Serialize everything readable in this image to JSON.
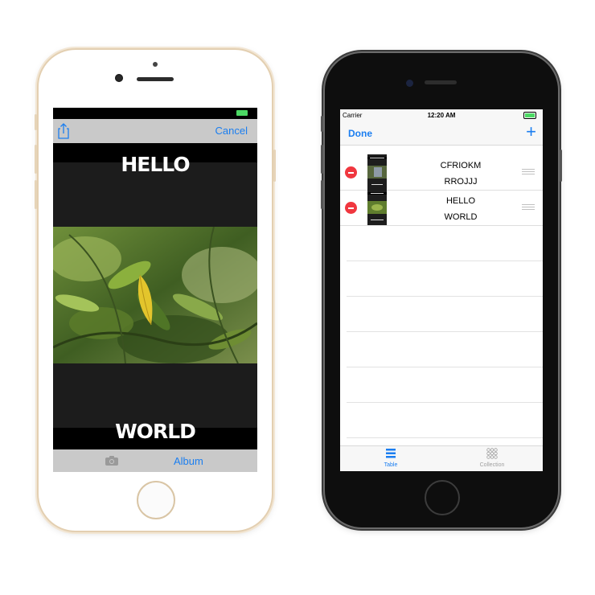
{
  "editor_screen": {
    "nav": {
      "cancel_label": "Cancel",
      "share_icon": "share-icon"
    },
    "top_text": "HELLO",
    "bottom_text": "WORLD",
    "toolbar": {
      "camera_icon": "camera-icon",
      "album_label": "Album"
    }
  },
  "list_screen": {
    "status": {
      "carrier": "Carrier",
      "time": "12:20 AM"
    },
    "nav": {
      "done_label": "Done",
      "add_label": "+"
    },
    "rows": [
      {
        "line1": "CFRIOKM",
        "line2": "RROJJJ"
      },
      {
        "line1": "HELLO",
        "line2": "WORLD"
      }
    ],
    "tabs": [
      {
        "label": "Table",
        "icon": "list-icon",
        "selected": true
      },
      {
        "label": "Collection",
        "icon": "grid-icon",
        "selected": false
      }
    ]
  },
  "colors": {
    "accent": "#1b7ef0",
    "delete": "#f0373f",
    "battery": "#4cd964"
  }
}
